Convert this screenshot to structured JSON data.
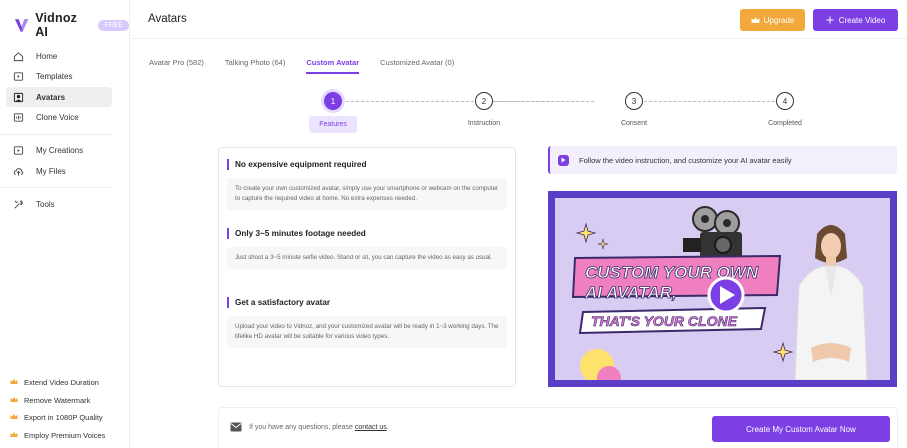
{
  "app": {
    "name": "Vidnoz AI",
    "badge": "FREE"
  },
  "sidebar": {
    "items": [
      {
        "label": "Home",
        "icon": "home-icon"
      },
      {
        "label": "Templates",
        "icon": "templates-icon"
      },
      {
        "label": "Avatars",
        "icon": "avatar-icon",
        "active": true
      },
      {
        "label": "Clone Voice",
        "icon": "voice-icon"
      }
    ],
    "items2": [
      {
        "label": "My Creations",
        "icon": "creations-icon"
      },
      {
        "label": "My Files",
        "icon": "cloud-upload-icon"
      }
    ],
    "items3": [
      {
        "label": "Tools",
        "icon": "tools-icon"
      }
    ],
    "promo": [
      "Extend Video Duration",
      "Remove Watermark",
      "Export in 1080P Quality",
      "Employ Premium Voices"
    ]
  },
  "header": {
    "title": "Avatars",
    "upgrade_label": "Upgrade",
    "create_label": "Create Video"
  },
  "tabs": [
    {
      "label": "Avatar Pro (582)"
    },
    {
      "label": "Talking Photo (64)"
    },
    {
      "label": "Custom Avatar",
      "active": true
    },
    {
      "label": "Customized Avatar (0)"
    }
  ],
  "stepper": {
    "current": 1,
    "steps": [
      {
        "num": "1",
        "label": "Features"
      },
      {
        "num": "2",
        "label": "Instruction"
      },
      {
        "num": "3",
        "label": "Consent"
      },
      {
        "num": "4",
        "label": "Completed"
      }
    ]
  },
  "features": [
    {
      "title": "No expensive equipment required",
      "desc": "To create your own customized avatar, simply use your smartphone or webcam on the computer to capture the required video at home. No extra expenses needed."
    },
    {
      "title": "Only 3~5 minutes footage needed",
      "desc": "Just shoot a 3~5 minute selfie video. Stand or sit, you can capture the video as easy as usual."
    },
    {
      "title": "Get a satisfactory avatar",
      "desc": "Upload your video to Vidnoz, and your customized avatar will be ready in 1~3 working days. The lifelike HD avatar will be suitable for various video types."
    }
  ],
  "instruction": {
    "text": "Follow the video instruction, and customize your AI avatar easily"
  },
  "banner": {
    "line1": "CUSTOM YOUR OWN",
    "line2": "AI AVATAR,",
    "line3": "THAT'S YOUR CLONE"
  },
  "footer": {
    "question": "If you have any questions, please",
    "contact": "contact us",
    "suffix": ".",
    "cta": "Create My Custom Avatar Now"
  },
  "colors": {
    "accent": "#7b3fe4",
    "upgrade": "#f0a93a",
    "banner_frame": "#5a3ec8",
    "banner_bg": "#d9ccf3",
    "pink": "#f07fbf"
  }
}
